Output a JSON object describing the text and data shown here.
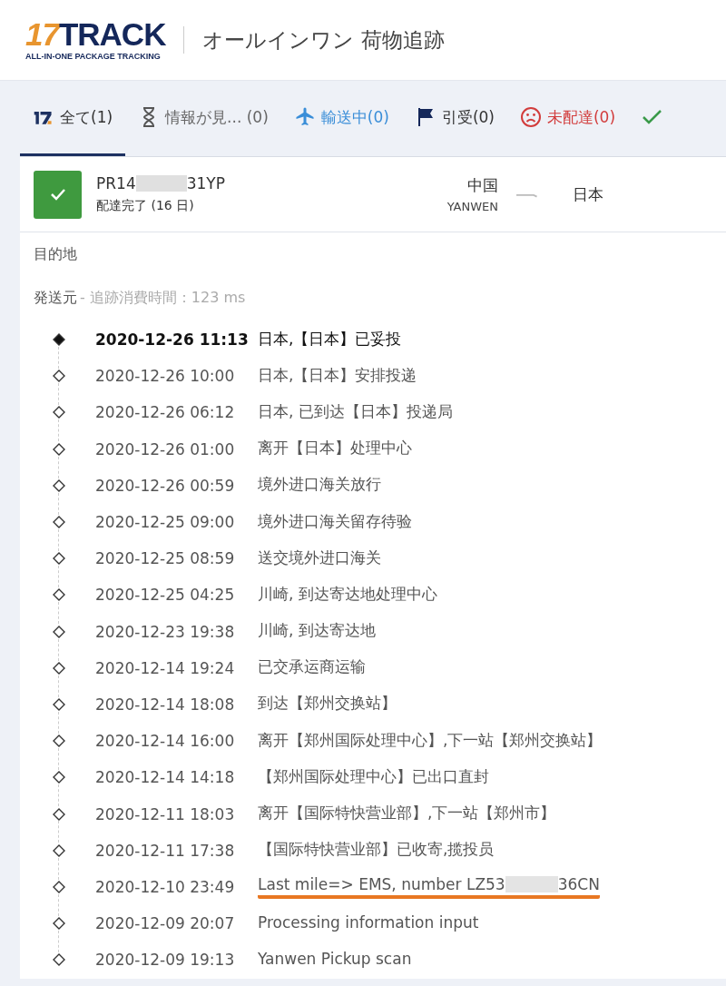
{
  "header": {
    "logo": {
      "mark": "17",
      "word": "TRACK",
      "tagline": "ALL-IN-ONE PACKAGE TRACKING"
    },
    "title": "オールインワン 荷物追跡"
  },
  "tabs": [
    {
      "kind": "all",
      "label": "全て(1)",
      "selected": true,
      "color": "#333333"
    },
    {
      "kind": "not_found",
      "label": "情報が見... (0)",
      "selected": false,
      "color": "#666666"
    },
    {
      "kind": "transit",
      "label": "輸送中(0)",
      "selected": false,
      "color": "#3a8ed8"
    },
    {
      "kind": "pickup",
      "label": "引受(0)",
      "selected": false,
      "color": "#333333"
    },
    {
      "kind": "undelivered",
      "label": "未配達(0)",
      "selected": false,
      "color": "#d23c3c"
    },
    {
      "kind": "delivered",
      "selected": false,
      "color": "#3a9a4a"
    }
  ],
  "shipment": {
    "number_start": "PR14",
    "number_end": "31YP",
    "status": "配達完了 (16 日)",
    "origin": "中国",
    "carrier": "YANWEN",
    "destination": "日本"
  },
  "destination_label": "目的地",
  "origin_label": "発送元",
  "timing": "- 追跡消費時間：123 ms",
  "events": [
    {
      "time": "2020-12-26 11:13",
      "text": "日本,【日本】已妥投",
      "current": true
    },
    {
      "time": "2020-12-26 10:00",
      "text": "日本,【日本】安排投递",
      "current": false
    },
    {
      "time": "2020-12-26 06:12",
      "text": "日本, 已到达【日本】投递局",
      "current": false
    },
    {
      "time": "2020-12-26 01:00",
      "text": "离开【日本】处理中心",
      "current": false
    },
    {
      "time": "2020-12-26 00:59",
      "text": "境外进口海关放行",
      "current": false
    },
    {
      "time": "2020-12-25 09:00",
      "text": "境外进口海关留存待验",
      "current": false
    },
    {
      "time": "2020-12-25 08:59",
      "text": "送交境外进口海关",
      "current": false
    },
    {
      "time": "2020-12-25 04:25",
      "text": "川崎, 到达寄达地处理中心",
      "current": false
    },
    {
      "time": "2020-12-23 19:38",
      "text": "川崎, 到达寄达地",
      "current": false
    },
    {
      "time": "2020-12-14 19:24",
      "text": "已交承运商运输",
      "current": false
    },
    {
      "time": "2020-12-14 18:08",
      "text": "到达【郑州交换站】",
      "current": false
    },
    {
      "time": "2020-12-14 16:00",
      "text": "离开【郑州国际处理中心】,下一站【郑州交换站】",
      "current": false
    },
    {
      "time": "2020-12-14 14:18",
      "text": "【郑州国际处理中心】已出口直封",
      "current": false
    },
    {
      "time": "2020-12-11 18:03",
      "text": "离开【国际特快营业部】,下一站【郑州市】",
      "current": false
    },
    {
      "time": "2020-12-11 17:38",
      "text": "【国际特快营业部】已收寄,揽投员",
      "current": false
    },
    {
      "time": "2020-12-10 23:49",
      "text": "Last mile=> EMS, number LZ53",
      "text_end": "36CN",
      "current": false,
      "underlined": true
    },
    {
      "time": "2020-12-09 20:07",
      "text": "Processing information input",
      "current": false
    },
    {
      "time": "2020-12-09 19:13",
      "text": "Yanwen Pickup scan",
      "current": false
    }
  ]
}
